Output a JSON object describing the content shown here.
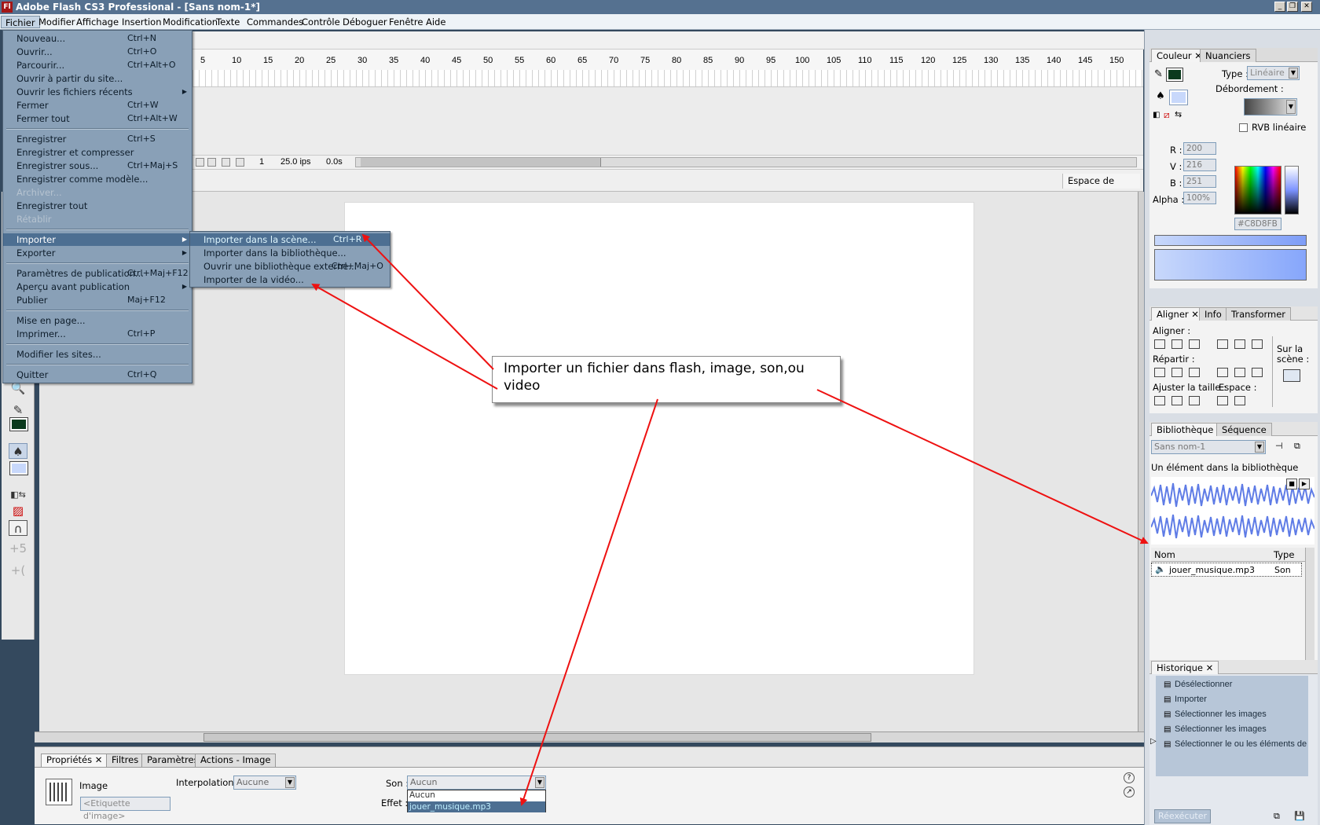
{
  "window": {
    "title": "Adobe Flash CS3 Professional - [Sans nom-1*]",
    "logo": "Fl",
    "buttons": [
      "_",
      "❐",
      "✕"
    ]
  },
  "menubar": {
    "items": [
      "Fichier",
      "Modifier",
      "Affichage",
      "Insertion",
      "Modification",
      "Texte",
      "Commandes",
      "Contrôle",
      "Déboguer",
      "Fenêtre",
      "Aide"
    ]
  },
  "file_menu": {
    "items": [
      {
        "label": "Nouveau...",
        "shortcut": "Ctrl+N"
      },
      {
        "label": "Ouvrir...",
        "shortcut": "Ctrl+O"
      },
      {
        "label": "Parcourir...",
        "shortcut": "Ctrl+Alt+O"
      },
      {
        "label": "Ouvrir à partir du site...",
        "shortcut": ""
      },
      {
        "label": "Ouvrir les fichiers récents",
        "shortcut": ""
      },
      {
        "label": "Fermer",
        "shortcut": "Ctrl+W"
      },
      {
        "label": "Fermer tout",
        "shortcut": "Ctrl+Alt+W"
      },
      {
        "label": "Enregistrer",
        "shortcut": "Ctrl+S"
      },
      {
        "label": "Enregistrer et compresser",
        "shortcut": ""
      },
      {
        "label": "Enregistrer sous...",
        "shortcut": "Ctrl+Maj+S"
      },
      {
        "label": "Enregistrer comme modèle...",
        "shortcut": ""
      },
      {
        "label": "Archiver...",
        "shortcut": ""
      },
      {
        "label": "Enregistrer tout",
        "shortcut": ""
      },
      {
        "label": "Rétablir",
        "shortcut": ""
      },
      {
        "label": "Importer",
        "shortcut": ""
      },
      {
        "label": "Exporter",
        "shortcut": ""
      },
      {
        "label": "Paramètres de publication...",
        "shortcut": "Ctrl+Maj+F12"
      },
      {
        "label": "Aperçu avant publication",
        "shortcut": ""
      },
      {
        "label": "Publier",
        "shortcut": "Maj+F12"
      },
      {
        "label": "Mise en page...",
        "shortcut": ""
      },
      {
        "label": "Imprimer...",
        "shortcut": "Ctrl+P"
      },
      {
        "label": "Modifier les sites...",
        "shortcut": ""
      },
      {
        "label": "Quitter",
        "shortcut": "Ctrl+Q"
      }
    ]
  },
  "import_submenu": {
    "items": [
      {
        "label": "Importer dans la scène...",
        "shortcut": "Ctrl+R"
      },
      {
        "label": "Importer dans la bibliothèque...",
        "shortcut": ""
      },
      {
        "label": "Ouvrir une bibliothèque externe...",
        "shortcut": "Ctrl+Maj+O"
      },
      {
        "label": "Importer de la vidéo...",
        "shortcut": ""
      }
    ]
  },
  "timeline": {
    "ruler": [
      "5",
      "10",
      "15",
      "20",
      "25",
      "30",
      "35",
      "40",
      "45",
      "50",
      "55",
      "60",
      "65",
      "70",
      "75",
      "80",
      "85",
      "90",
      "95",
      "100",
      "105",
      "110",
      "115",
      "120",
      "125",
      "130",
      "135",
      "140",
      "145",
      "150"
    ],
    "current_frame": "1",
    "fps": "25.0 ips",
    "time": "0.0s"
  },
  "edit_bar": {
    "workspace": "Espace de travail"
  },
  "callout": {
    "text": "Importer un fichier dans flash, image, son,ou video"
  },
  "properties": {
    "tabs": [
      "Propriétés",
      "Filtres",
      "Paramètres",
      "Actions - Image"
    ],
    "frame_label": "Image",
    "frame_placeholder": "<Etiquette d'image>",
    "interpolation_label": "Interpolation :",
    "interpolation_value": "Aucune",
    "sound_label": "Son :",
    "sound_value": "Aucun",
    "effect_label": "Effet :",
    "sound_options": [
      "Aucun",
      "jouer_musique.mp3"
    ]
  },
  "color_panel": {
    "tabs": [
      "Couleur",
      "Nuanciers"
    ],
    "type_label": "Type :",
    "type_value": "Linéaire",
    "overflow_label": "Débordement :",
    "rgb_linear": "RVB linéaire",
    "r_label": "R :",
    "r_value": "200",
    "v_label": "V :",
    "v_value": "216",
    "b_label": "B :",
    "b_value": "251",
    "alpha_label": "Alpha :",
    "alpha_value": "100%",
    "hex": "#C8D8FB",
    "accent": "#C8D8FB"
  },
  "align_panel": {
    "tabs": [
      "Aligner",
      "Info",
      "Transformer"
    ],
    "align_label": "Aligner :",
    "distribute_label": "Répartir :",
    "match_label": "Ajuster la taille :",
    "space_label": "Espace :",
    "to_stage": "Sur la scène :"
  },
  "library_panel": {
    "tabs": [
      "Bibliothèque",
      "Séquence"
    ],
    "doc": "Sans nom-1",
    "count": "Un élément dans la bibliothèque",
    "col_name": "Nom",
    "col_type": "Type",
    "items": [
      {
        "name": "jouer_musique.mp3",
        "type": "Son"
      }
    ]
  },
  "history_panel": {
    "tabs": [
      "Historique"
    ],
    "items": [
      "Désélectionner",
      "Importer",
      "Sélectionner les images",
      "Sélectionner les images",
      "Sélectionner le ou les éléments de"
    ],
    "replay": "Réexécuter"
  }
}
